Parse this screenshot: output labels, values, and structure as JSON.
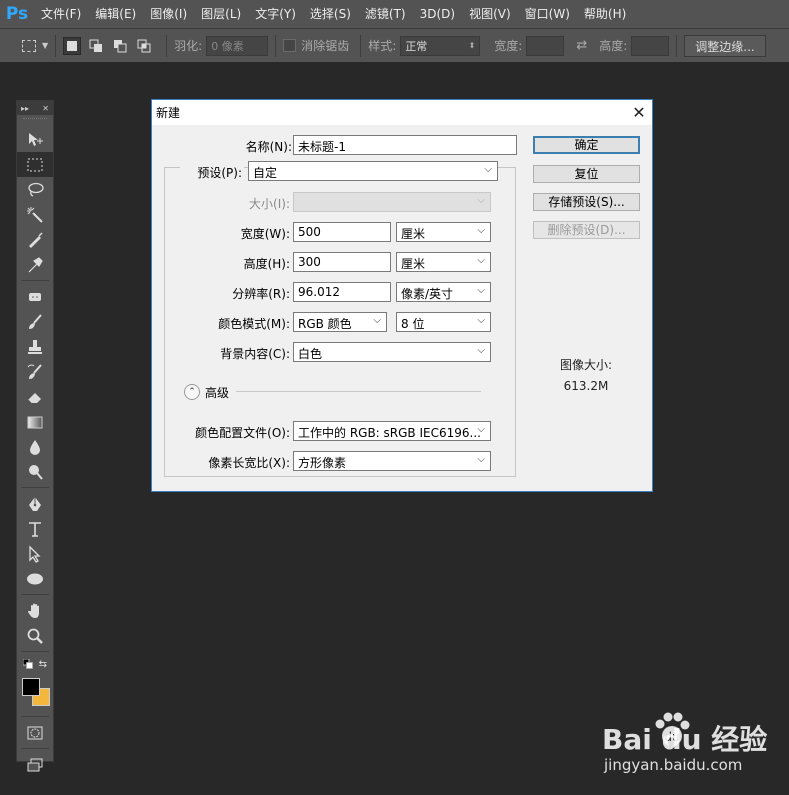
{
  "app": {
    "logo": "Ps"
  },
  "menu": [
    "文件(F)",
    "编辑(E)",
    "图像(I)",
    "图层(L)",
    "文字(Y)",
    "选择(S)",
    "滤镜(T)",
    "3D(D)",
    "视图(V)",
    "窗口(W)",
    "帮助(H)"
  ],
  "options": {
    "feather_label": "羽化:",
    "feather_value": "0 像素",
    "antialias_label": "消除锯齿",
    "style_label": "样式:",
    "style_value": "正常",
    "width_label": "宽度:",
    "height_label": "高度:",
    "refine_button": "调整边缘..."
  },
  "dialog": {
    "title": "新建",
    "close": "✕",
    "name_label": "名称(N):",
    "name_value": "未标题-1",
    "preset_label": "预设(P):",
    "preset_value": "自定",
    "size_label": "大小(I):",
    "width_label": "宽度(W):",
    "width_value": "500",
    "width_unit": "厘米",
    "height_label": "高度(H):",
    "height_value": "300",
    "height_unit": "厘米",
    "resolution_label": "分辨率(R):",
    "resolution_value": "96.012",
    "resolution_unit": "像素/英寸",
    "color_mode_label": "颜色模式(M):",
    "color_mode_value": "RGB 颜色",
    "bit_depth_value": "8 位",
    "background_label": "背景内容(C):",
    "background_value": "白色",
    "advanced_label": "高级",
    "profile_label": "颜色配置文件(O):",
    "profile_value": "工作中的 RGB: sRGB IEC6196...",
    "pixel_aspect_label": "像素长宽比(X):",
    "pixel_aspect_value": "方形像素",
    "ok_button": "确定",
    "reset_button": "复位",
    "save_preset_button": "存储预设(S)...",
    "delete_preset_button": "删除预设(D)...",
    "image_size_label": "图像大小:",
    "image_size_value": "613.2M"
  },
  "watermark": {
    "main": "Bai  du 经验",
    "sub": "jingyan.baidu.com"
  },
  "colors": {
    "foreground": "#000000",
    "background": "#f4b73e",
    "accent": "#3c7fb1"
  }
}
